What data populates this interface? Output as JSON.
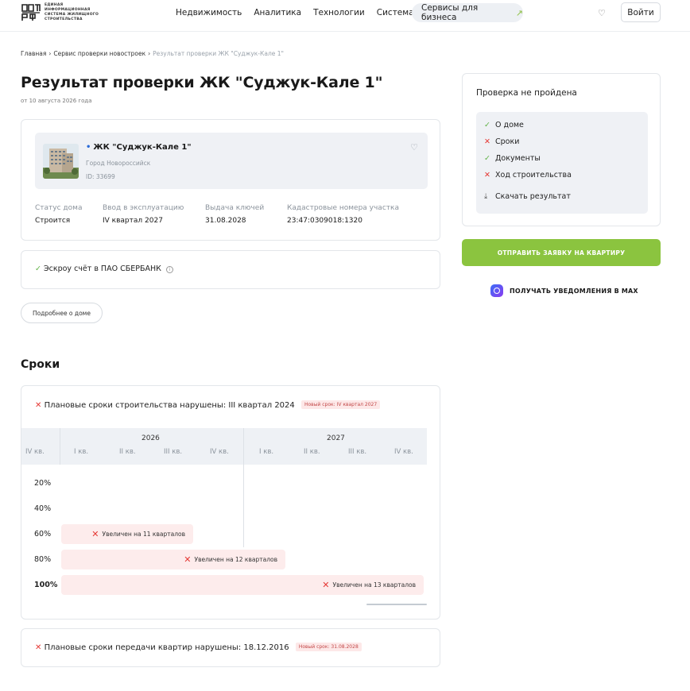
{
  "header": {
    "logo_text": [
      "ЕДИНАЯ",
      "ИНФОРМАЦИОННАЯ",
      "СИСТЕМА ЖИЛИЩНОГО",
      "СТРОИТЕЛЬСТВА"
    ],
    "nav": [
      "Недвижимость",
      "Аналитика",
      "Технологии",
      "Система"
    ],
    "business_label": "Сервисы для бизнеса",
    "login_label": "Войти"
  },
  "breadcrumb": {
    "home": "Главная",
    "service": "Сервис проверки новостроек",
    "current": "Результат проверки ЖК \"Суджук-Кале 1\""
  },
  "page": {
    "title": "Результат проверки ЖК \"Суджук-Кале 1\"",
    "date": "от 10 августа 2026 года"
  },
  "house": {
    "name": "ЖК \"Суджук-Кале 1\"",
    "city": "Город Новороссийск",
    "id": "ID: 33699",
    "facts": [
      {
        "label": "Статус дома",
        "value": "Строится"
      },
      {
        "label": "Ввод в эксплуатацию",
        "value": "IV квартал 2027"
      },
      {
        "label": "Выдача ключей",
        "value": "31.08.2028"
      },
      {
        "label": "Кадастровые номера участка",
        "value": "23:47:0309018:1320"
      }
    ]
  },
  "escrow": {
    "text": "Эскроу счёт в ПАО СБЕРБАНК"
  },
  "more_button": "Подробнее о доме",
  "terms": {
    "section_title": "Сроки",
    "construction_violation": "Плановые сроки строительства нарушены: III квартал 2024",
    "construction_new": "Новый срок: IV квартал 2027",
    "timeline": {
      "years": [
        "2026",
        "2027"
      ],
      "quarters": [
        "IV кв.",
        "I кв.",
        "II кв.",
        "III кв.",
        "IV кв.",
        "I кв.",
        "II кв.",
        "III кв.",
        "IV кв."
      ],
      "rows": [
        {
          "label": "20%",
          "bar": ""
        },
        {
          "label": "40%",
          "bar": ""
        },
        {
          "label": "60%",
          "bar": "Увеличен на 11 кварталов"
        },
        {
          "label": "80%",
          "bar": "Увеличен на 12 кварталов"
        },
        {
          "label": "100%",
          "bar": "Увеличен на 13 кварталов"
        }
      ]
    },
    "handover_violation": "Плановые сроки передачи квартир нарушены: 18.12.2016",
    "handover_new": "Новый срок: 31.08.2028"
  },
  "check": {
    "title": "Проверка не пройдена",
    "items": [
      {
        "label": "О доме",
        "status": "ok"
      },
      {
        "label": "Сроки",
        "status": "fail"
      },
      {
        "label": "Документы",
        "status": "ok"
      },
      {
        "label": "Ход строительства",
        "status": "fail"
      }
    ],
    "download": "Скачать результат"
  },
  "cta_label": "ОТПРАВИТЬ ЗАЯВКУ НА КВАРТИРУ",
  "notify_label": "ПОЛУЧАТЬ УВЕДОМЛЕНИЯ В MAX",
  "colors": {
    "accent_green": "#8bc43f",
    "fail_red": "#e53935",
    "ok_green": "#5fb244"
  }
}
